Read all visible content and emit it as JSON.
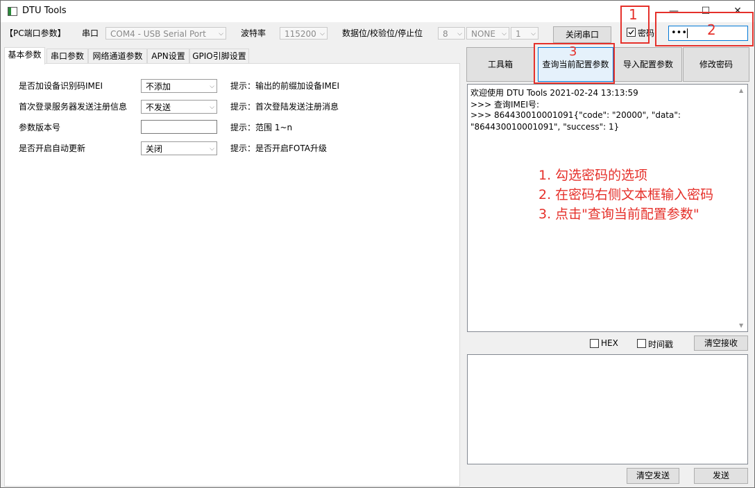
{
  "window": {
    "title": "DTU Tools"
  },
  "pc_port": {
    "section_label": "【PC端口参数】",
    "port_label": "串口",
    "port_value": "COM4 - USB Serial Port",
    "baud_label": "波特率",
    "baud_value": "115200",
    "frame_label": "数据位/校验位/停止位",
    "databits_value": "8",
    "parity_value": "NONE",
    "stopbits_value": "1",
    "close_port_button": "关闭串口",
    "password_checkbox_label": "密码",
    "password_checked": true,
    "password_value": "•••"
  },
  "tabs": [
    "基本参数",
    "串口参数",
    "网络通道参数",
    "APN设置",
    "GPIO引脚设置"
  ],
  "basic_params": [
    {
      "label": "是否加设备识别码IMEI",
      "control": "select",
      "value": "不添加",
      "hint": "提示：输出的前缀加设备IMEI"
    },
    {
      "label": "首次登录服务器发送注册信息",
      "control": "select",
      "value": "不发送",
      "hint": "提示：首次登陆发送注册消息"
    },
    {
      "label": "参数版本号",
      "control": "input",
      "value": "",
      "hint": "提示：范围 1~n"
    },
    {
      "label": "是否开启自动更新",
      "control": "select",
      "value": "关闭",
      "hint": "提示：是否开启FOTA升级"
    }
  ],
  "actions": {
    "toolbox": "工具箱",
    "query_config": "查询当前配置参数",
    "import_config": "导入配置参数",
    "change_password": "修改密码"
  },
  "log": [
    "欢迎使用 DTU Tools 2021-02-24 13:13:59",
    ">>> 查询IMEI号:",
    ">>> 864430010001091{\"code\": \"20000\", \"data\":",
    "\"864430010001091\", \"success\": 1}"
  ],
  "receive_options": {
    "hex_label": "HEX",
    "timestamp_label": "时间戳",
    "clear_receive_button": "清空接收"
  },
  "send_area": {
    "clear_send_button": "清空发送",
    "send_button": "发送"
  },
  "annotations": {
    "markers": [
      "1",
      "2",
      "3"
    ],
    "steps": [
      "1. 勾选密码的选项",
      "2. 在密码右侧文本框输入密码",
      "3. 点击\"查询当前配置参数\""
    ],
    "color": "#e5302a"
  }
}
